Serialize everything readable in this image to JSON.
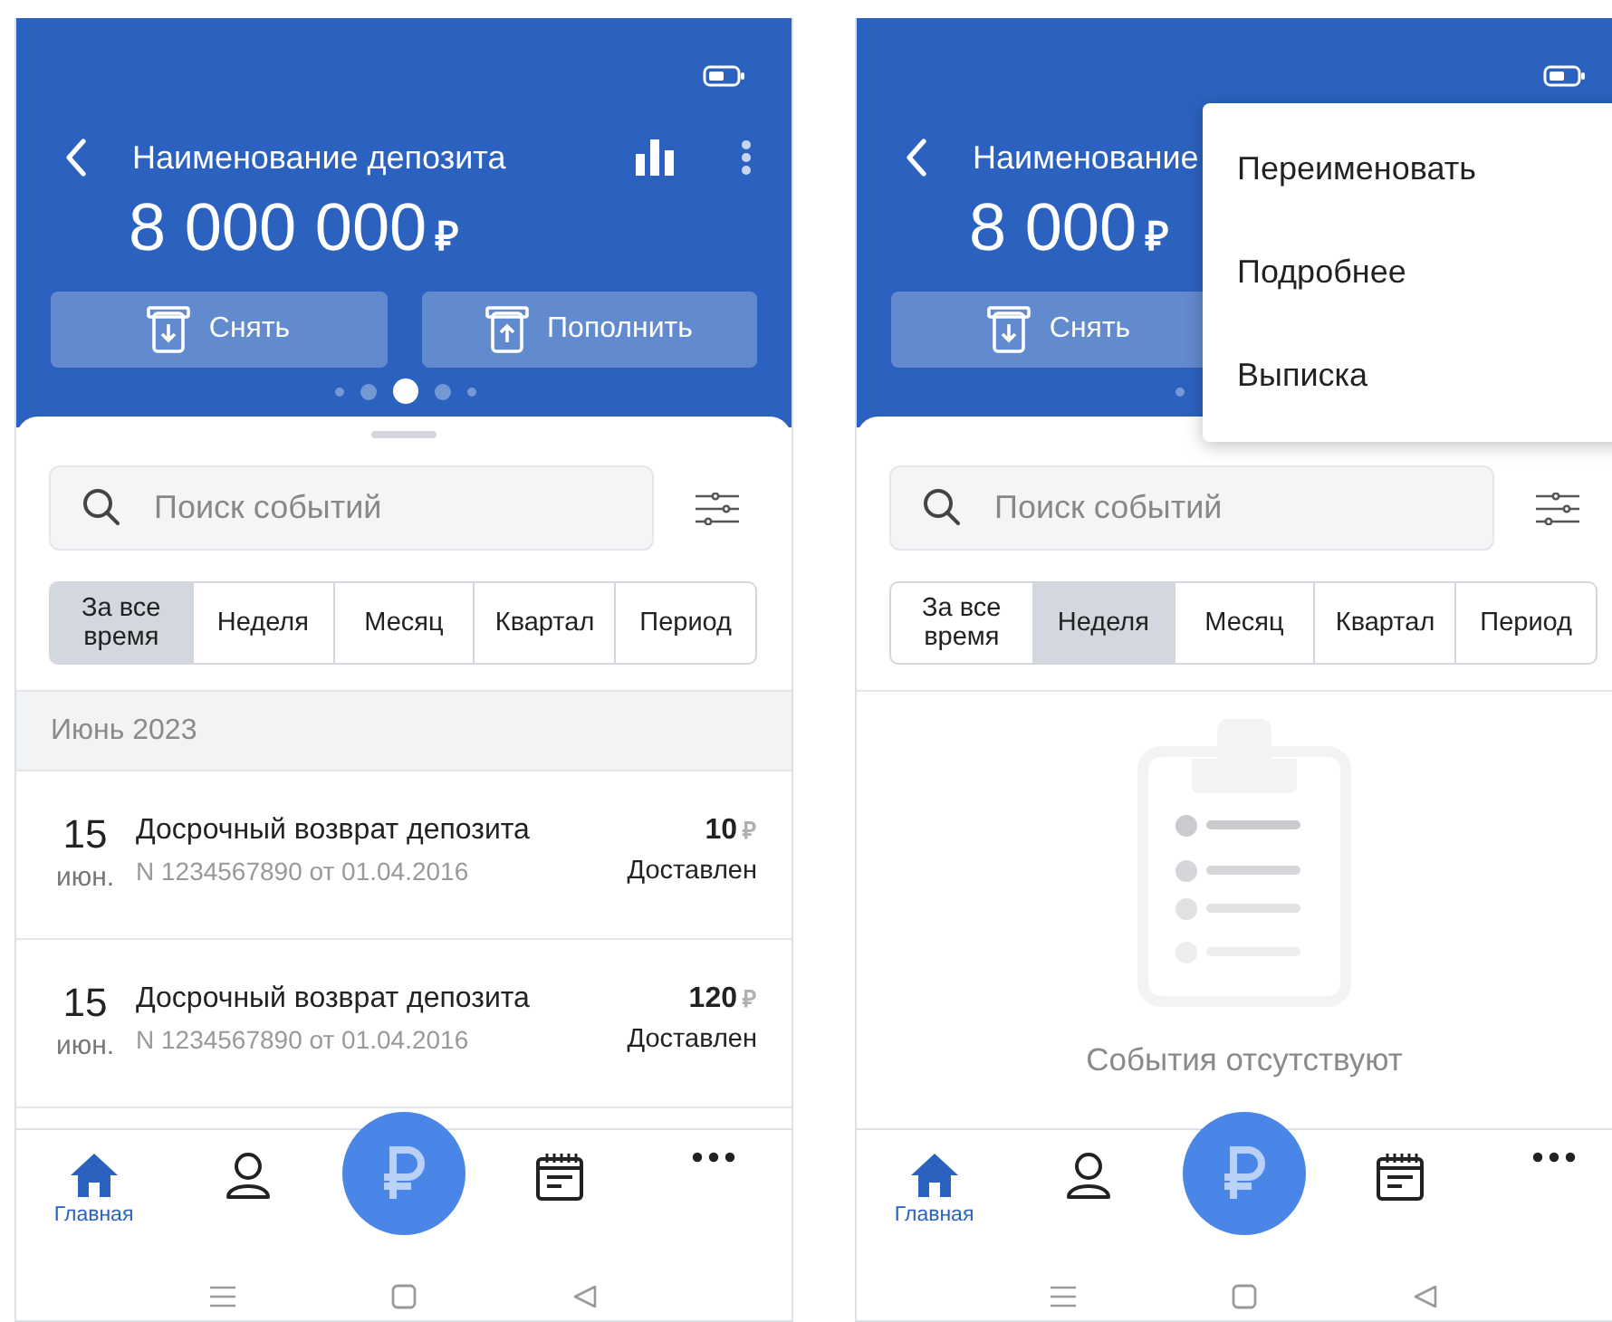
{
  "screens": [
    {
      "header": {
        "title": "Наименование депозита",
        "amount": "8 000 000",
        "currency": "₽",
        "tools_visible": true,
        "actions": [
          {
            "kind": "withdraw",
            "label": "Снять"
          },
          {
            "kind": "deposit",
            "label": "Пополнить"
          }
        ],
        "pager": [
          {
            "selected": false
          },
          {
            "selected": false
          },
          {
            "selected": true
          },
          {
            "selected": false
          },
          {
            "selected": false
          }
        ]
      },
      "search": {
        "placeholder": "Поиск событий"
      },
      "periods": [
        {
          "label": "За все время",
          "selected": true
        },
        {
          "label": "Неделя",
          "selected": false
        },
        {
          "label": "Месяц",
          "selected": false
        },
        {
          "label": "Квартал",
          "selected": false
        },
        {
          "label": "Период",
          "selected": false
        }
      ],
      "content": {
        "kind": "events",
        "groups": [
          {
            "title": "Июнь 2023",
            "events": [
              {
                "day": "15",
                "month": "июн.",
                "title": "Досрочный возврат депозита",
                "subtitle": "N 1234567890 от 01.04.2016",
                "amount": "10",
                "currency": "₽",
                "status": "Доставлен"
              },
              {
                "day": "15",
                "month": "июн.",
                "title": "Досрочный возврат депозита",
                "subtitle": "N 1234567890 от 01.04.2016",
                "amount": "120",
                "currency": "₽",
                "status": "Доставлен"
              }
            ]
          }
        ]
      },
      "nav": [
        {
          "kind": "home",
          "label": "Главная",
          "selected": true
        },
        {
          "kind": "profile",
          "selected": false
        },
        {
          "kind": "ruble",
          "selected": false
        },
        {
          "kind": "calendar",
          "selected": false
        },
        {
          "kind": "more",
          "selected": false
        }
      ]
    },
    {
      "header": {
        "title": "Наименование",
        "amount": "8 000",
        "currency": "₽",
        "tools_visible": false,
        "actions": [
          {
            "kind": "withdraw",
            "label": "Снять"
          }
        ],
        "pager": [
          {
            "selected": false
          }
        ]
      },
      "search": {
        "placeholder": "Поиск событий"
      },
      "periods": [
        {
          "label": "За все время",
          "selected": false
        },
        {
          "label": "Неделя",
          "selected": true
        },
        {
          "label": "Месяц",
          "selected": false
        },
        {
          "label": "Квартал",
          "selected": false
        },
        {
          "label": "Период",
          "selected": false
        }
      ],
      "content": {
        "kind": "empty",
        "message": "События отсутствуют"
      },
      "nav": [
        {
          "kind": "home",
          "label": "Главная",
          "selected": true
        },
        {
          "kind": "profile",
          "selected": false
        },
        {
          "kind": "ruble",
          "selected": false
        },
        {
          "kind": "calendar",
          "selected": false
        },
        {
          "kind": "more",
          "selected": false
        }
      ],
      "menu": {
        "items": [
          "Переименовать",
          "Подробнее",
          "Выписка"
        ]
      }
    }
  ]
}
